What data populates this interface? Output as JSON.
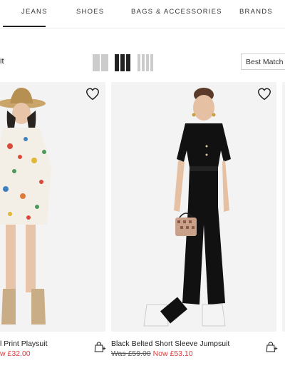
{
  "nav": {
    "items": [
      {
        "label": "JEANS",
        "active": true
      },
      {
        "label": "SHOES",
        "active": false
      },
      {
        "label": "BAGS & ACCESSORIES",
        "active": false
      },
      {
        "label": "BRANDS",
        "active": false
      }
    ]
  },
  "toolbar": {
    "filter_label": "it",
    "view_options": [
      "2-column-view-icon",
      "3-column-view-icon",
      "4-column-view-icon"
    ],
    "active_view": "3-column-view-icon",
    "sort_value": "Best Match"
  },
  "products": [
    {
      "name": "l Print Playsuit",
      "price_prefix": "w",
      "price_now": "£32.00",
      "favorite_icon": "heart-icon",
      "bag_icon": "add-to-bag-icon"
    },
    {
      "name": "Black Belted Short Sleeve Jumpsuit",
      "price_was": "Was £59.00",
      "price_now": "Now £53.10",
      "favorite_icon": "heart-icon",
      "bag_icon": "add-to-bag-icon"
    }
  ],
  "colors": {
    "sale_red": "#e03a3a",
    "text": "#222222",
    "view_active": "#222222",
    "view_inactive": "#cccccc"
  }
}
